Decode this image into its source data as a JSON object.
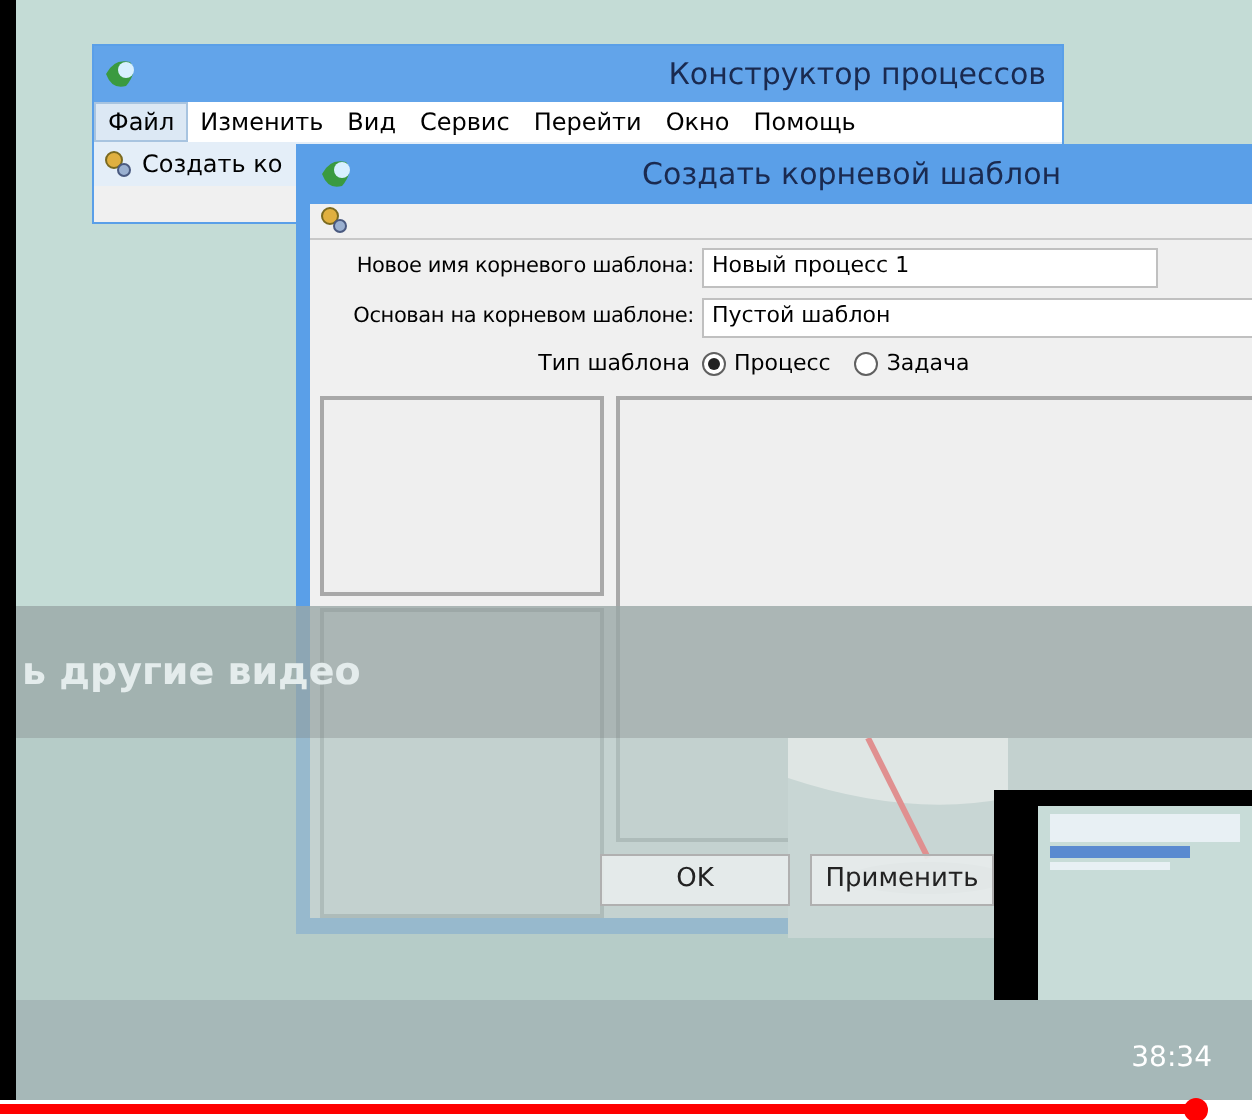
{
  "video": {
    "back_window": {
      "title": "Конструктор процессов",
      "menu": [
        {
          "label": "Файл",
          "selected": true
        },
        {
          "label": "Изменить",
          "selected": false
        },
        {
          "label": "Вид",
          "selected": false
        },
        {
          "label": "Сервис",
          "selected": false
        },
        {
          "label": "Перейти",
          "selected": false
        },
        {
          "label": "Окно",
          "selected": false
        },
        {
          "label": "Помощь",
          "selected": false
        }
      ],
      "toolbar_button": "Создать ко"
    },
    "dialog": {
      "title": "Создать корневой шаблон",
      "fields": [
        {
          "label": "Новое имя корневого шаблона:",
          "value": "Новый процесс 1"
        },
        {
          "label": "Основан на корневом шаблоне:",
          "value": "Пустой шаблон"
        }
      ],
      "type_label": "Тип шаблона",
      "radios": [
        {
          "label": "Процесс",
          "selected": true
        },
        {
          "label": "Задача",
          "selected": false
        }
      ],
      "buttons": [
        "OK",
        "Применить"
      ]
    }
  },
  "overlay": {
    "title": "ь другие видео"
  },
  "player": {
    "time": "38:34",
    "progress": {
      "level": 0.955
    }
  }
}
